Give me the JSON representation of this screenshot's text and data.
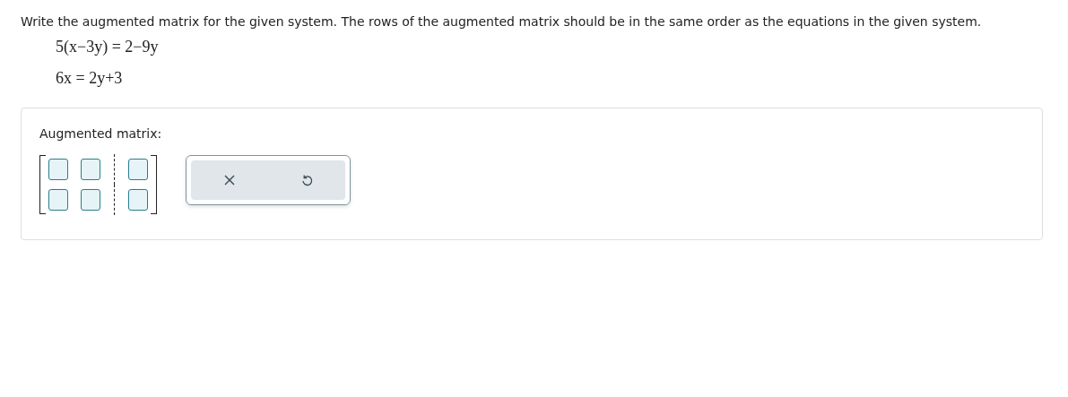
{
  "instructions": "Write the augmented matrix for the given system. The rows of the augmented matrix should be in the same order as the equations in the given system.",
  "equations": [
    "5(x−3y) = 2−9y",
    "6x = 2y+3"
  ],
  "answer": {
    "label": "Augmented matrix:",
    "matrix_rows": [
      {
        "cells": [
          {
            "kind": "coefficient"
          },
          {
            "kind": "coefficient"
          },
          {
            "kind": "constant"
          }
        ]
      },
      {
        "cells": [
          {
            "kind": "coefficient"
          },
          {
            "kind": "coefficient"
          },
          {
            "kind": "constant"
          }
        ]
      }
    ],
    "tools": [
      {
        "kind": "clear"
      },
      {
        "kind": "undo"
      }
    ]
  }
}
